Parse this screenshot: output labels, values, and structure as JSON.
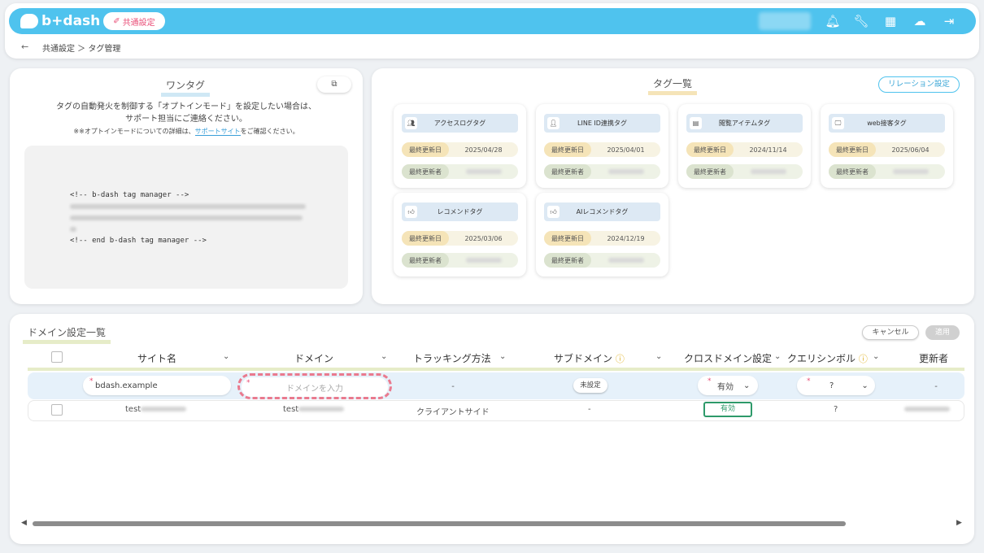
{
  "header": {
    "logo_text": "b+dash",
    "shared_settings_label": "共通設定",
    "icons": [
      "bell-icon",
      "wrench-icon",
      "grid-icon",
      "robot-icon",
      "logout-icon"
    ]
  },
  "breadcrumb": {
    "back": "←",
    "path": "共通設定 ＞ タグ管理"
  },
  "onetag": {
    "title": "ワンタグ",
    "copy_label": "⧉",
    "desc_line1": "タグの自動発火を制御する「オプトインモード」を設定したい場合は、",
    "desc_line2": "サポート担当にご連絡ください。",
    "note_prefix": "※※オプトインモードについての詳細は、",
    "note_link": "サポートサイト",
    "note_suffix": "をご確認ください。",
    "code_start": "<!-- b-dash tag manager -->",
    "code_end": "<!-- end b-dash tag manager -->"
  },
  "taglist": {
    "title": "タグ一覧",
    "relation_button": "リレーション設定",
    "date_label": "最終更新日",
    "user_label": "最終更新者",
    "cards": [
      {
        "name": "アクセスログタグ",
        "icon": "users-icon",
        "date": "2025/04/28"
      },
      {
        "name": "LINE ID連携タグ",
        "icon": "user-icon",
        "date": "2025/04/01"
      },
      {
        "name": "閲覧アイテムタグ",
        "icon": "book-icon",
        "date": "2024/11/14"
      },
      {
        "name": "web接客タグ",
        "icon": "monitor-icon",
        "date": "2025/06/04"
      },
      {
        "name": "レコメンドタグ",
        "icon": "thumbs-up-icon",
        "date": "2025/03/06"
      },
      {
        "name": "AIレコメンドタグ",
        "icon": "thumbs-up-icon",
        "date": "2024/12/19"
      }
    ]
  },
  "domain": {
    "title": "ドメイン設定一覧",
    "cancel_label": "キャンセル",
    "apply_label": "適用",
    "columns": {
      "site_name": "サイト名",
      "domain": "ドメイン",
      "tracking": "トラッキング方法",
      "subdomain": "サブドメイン",
      "cross_domain": "クロスドメイン設定",
      "query_symbol": "クエリシンボル",
      "updater": "更新者"
    },
    "edit_row": {
      "site_name_value": "bdash.example",
      "domain_placeholder": "ドメインを入力",
      "tracking": "-",
      "subdomain_button": "未設定",
      "cross_domain_value": "有効",
      "query_symbol_value": "?",
      "updater": "-"
    },
    "data_row": {
      "site_name": "test",
      "domain": "test",
      "tracking": "クライアントサイド",
      "subdomain": "-",
      "cross_domain": "有効",
      "query_symbol": "?"
    }
  },
  "colors": {
    "accent": "#4fc3ee",
    "brand_pink": "#e94e77",
    "valid_green": "#2e9a6a"
  }
}
